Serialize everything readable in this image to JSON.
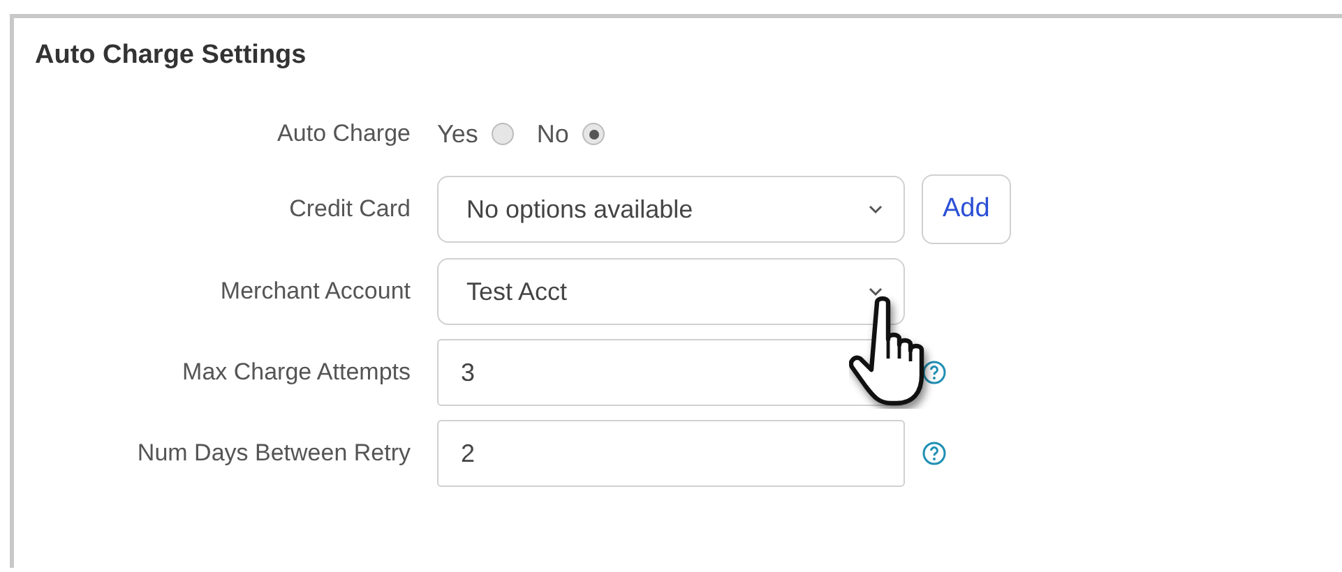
{
  "panel": {
    "title": "Auto Charge Settings"
  },
  "fields": [
    {
      "kind": "radio",
      "label": "Auto Charge",
      "options": [
        {
          "label": "Yes",
          "selected": false
        },
        {
          "label": "No",
          "selected": true
        }
      ]
    },
    {
      "kind": "select",
      "label": "Credit Card",
      "value": "No options available",
      "button": "Add"
    },
    {
      "kind": "select",
      "label": "Merchant Account",
      "value": "Test Acct"
    },
    {
      "kind": "input",
      "label": "Max Charge Attempts",
      "value": "3",
      "help": true
    },
    {
      "kind": "input",
      "label": "Num Days Between Retry",
      "value": "2",
      "help": true
    }
  ]
}
